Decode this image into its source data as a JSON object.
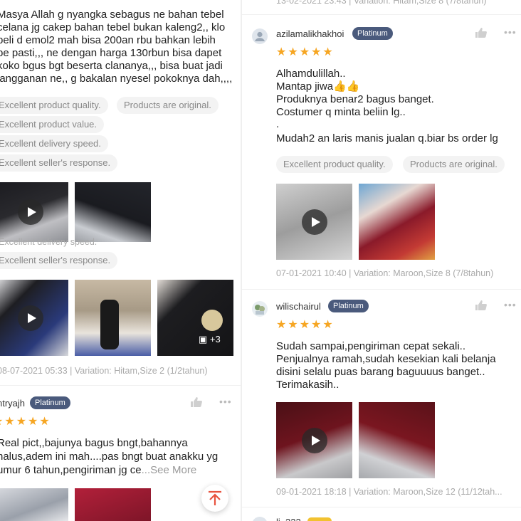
{
  "left": {
    "review1": {
      "lines": [
        "Masya Allah g nyangka sebagus ne bahan tebel",
        "celana jg cakep bahan tebel bukan kaleng2,, klo",
        "beli d emol2 mah bisa 200an rbu bahkan lebih",
        "pe pasti,,, ne dengan harga 130rbun bisa dapet",
        "koko bgus bgt beserta clananya,,, bisa buat jadi",
        "langganan ne,, g bakalan nyesel pokoknya dah,,,,"
      ],
      "tags": [
        "Excellent product quality.",
        "Products are original.",
        "Excellent product value.",
        "Excellent delivery speed.",
        "Excellent seller's response."
      ],
      "overlay_text_1": "Excellent delivery speed.",
      "overlay_text_2": "Excellent seller's response.",
      "photo_more": "+3",
      "meta": "08-07-2021 05:33 | Variation: Hitam,Size 2 (1/2tahun)"
    },
    "review2": {
      "username": "ntryajh",
      "badge": "Platinum",
      "stars": "★★★★★",
      "lines": [
        "Real pict,,bajunya bagus bngt,bahannya",
        "halus,adem ini mah....pas bngt buat anakku yg",
        "umur 6 tahun,pengiriman jg ce"
      ],
      "see_more": "...See More"
    }
  },
  "right": {
    "top_meta": "13-02-2021 23:43 | Variation: Hitam,Size 8 (7/8tahun)",
    "review1": {
      "username": "azilamalikhakhoi",
      "badge": "Platinum",
      "stars": "★★★★★",
      "lines": [
        "Alhamdulillah..",
        "Mantap jiwa👍👍",
        "Produknya benar2 bagus banget.",
        "Costumer q minta beliin lg..",
        ".",
        "Mudah2 an laris manis jualan q.biar bs order lg"
      ],
      "tags": [
        "Excellent product quality.",
        "Products are original."
      ],
      "meta": "07-01-2021 10:40 | Variation: Maroon,Size 8 (7/8tahun)"
    },
    "review2": {
      "username": "wilischairul",
      "badge": "Platinum",
      "stars": "★★★★★",
      "lines": [
        "Sudah sampai,pengiriman cepat sekali..",
        "Penjualnya ramah,sudah kesekian kali belanja",
        "disini selalu puas barang baguuuus banget..",
        "Terimakasih.."
      ],
      "meta": "09-01-2021 18:18 | Variation: Maroon,Size 12 (11/12tah..."
    },
    "review3": {
      "username": "li_222"
    }
  },
  "colors": {
    "star": "#f6a623",
    "badge": "#4a5a7c",
    "fab": "#e8533f"
  },
  "icons": [
    "like-icon",
    "more-icon",
    "play-icon",
    "image-icon",
    "scroll-top-icon"
  ]
}
